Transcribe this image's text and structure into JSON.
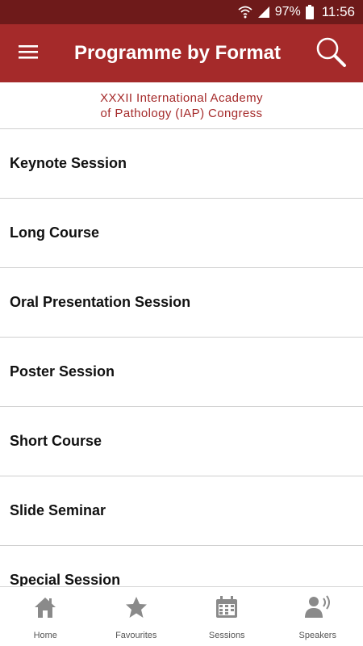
{
  "status_bar": {
    "battery": "97%",
    "time": "11:56"
  },
  "app_bar": {
    "title": "Programme by Format"
  },
  "header": {
    "line1": "XXXII International Academy",
    "line2": "of Pathology (IAP) Congress"
  },
  "list": {
    "items": [
      {
        "label": "Keynote Session"
      },
      {
        "label": "Long Course"
      },
      {
        "label": "Oral Presentation Session"
      },
      {
        "label": "Poster Session"
      },
      {
        "label": "Short Course"
      },
      {
        "label": "Slide Seminar"
      },
      {
        "label": "Special Session"
      }
    ]
  },
  "bottom_nav": {
    "items": [
      {
        "label": "Home",
        "icon": "home-icon"
      },
      {
        "label": "Favourites",
        "icon": "star-icon"
      },
      {
        "label": "Sessions",
        "icon": "calendar-icon"
      },
      {
        "label": "Speakers",
        "icon": "speaker-icon"
      }
    ]
  },
  "colors": {
    "app_bar": "#a52a2a",
    "status_bar": "#6e1a1a",
    "accent_text": "#a52a2a"
  }
}
